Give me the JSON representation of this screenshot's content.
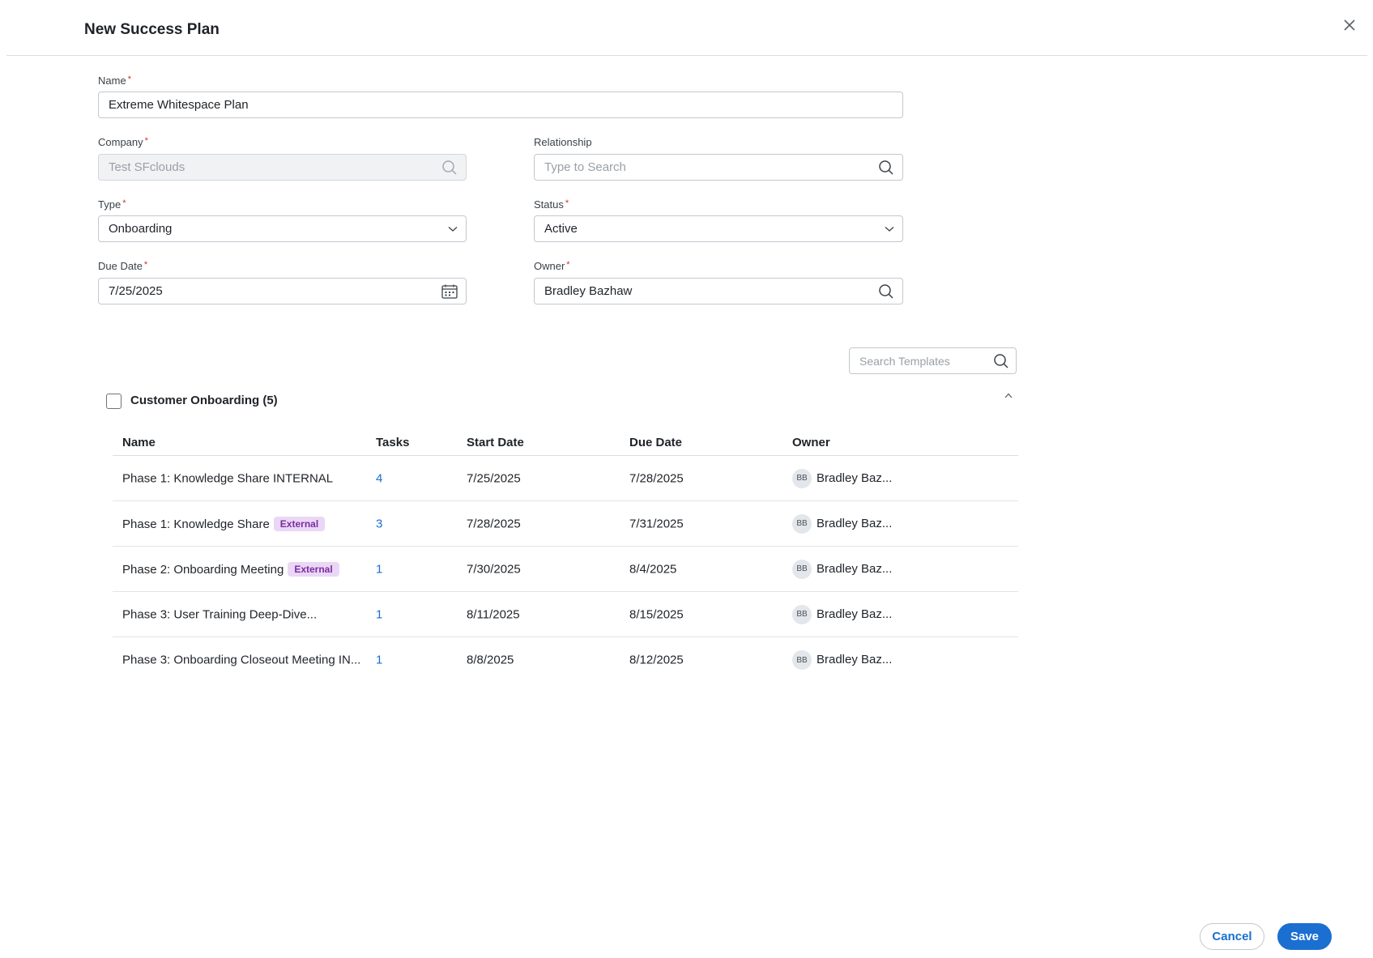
{
  "modal": {
    "title": "New Success Plan"
  },
  "form": {
    "name": {
      "label": "Name",
      "required_mark": "*",
      "value": "Extreme Whitespace Plan"
    },
    "company": {
      "label": "Company",
      "required_mark": "*",
      "value": "Test SFclouds"
    },
    "relationship": {
      "label": "Relationship",
      "placeholder": "Type to Search"
    },
    "type": {
      "label": "Type",
      "required_mark": "*",
      "value": "Onboarding"
    },
    "status": {
      "label": "Status",
      "required_mark": "*",
      "value": "Active"
    },
    "due_date": {
      "label": "Due Date",
      "required_mark": "*",
      "value": "7/25/2025"
    },
    "owner": {
      "label": "Owner",
      "required_mark": "*",
      "value": "Bradley Bazhaw"
    }
  },
  "templates": {
    "search_placeholder": "Search Templates",
    "group_title": "Customer Onboarding (5)",
    "columns": {
      "name": "Name",
      "tasks": "Tasks",
      "start": "Start Date",
      "due": "Due Date",
      "owner": "Owner"
    },
    "rows": [
      {
        "name": "Phase 1: Knowledge Share INTERNAL",
        "badge": "",
        "tasks": "4",
        "start": "7/25/2025",
        "due": "7/28/2025",
        "initials": "BB",
        "owner": "Bradley Baz..."
      },
      {
        "name": "Phase 1: Knowledge Share",
        "badge": "External",
        "tasks": "3",
        "start": "7/28/2025",
        "due": "7/31/2025",
        "initials": "BB",
        "owner": "Bradley Baz..."
      },
      {
        "name": "Phase 2: Onboarding Meeting",
        "badge": "External",
        "tasks": "1",
        "start": "7/30/2025",
        "due": "8/4/2025",
        "initials": "BB",
        "owner": "Bradley Baz..."
      },
      {
        "name": "Phase 3: User Training Deep-Dive...",
        "badge": "",
        "tasks": "1",
        "start": "8/11/2025",
        "due": "8/15/2025",
        "initials": "BB",
        "owner": "Bradley Baz..."
      },
      {
        "name": "Phase 3: Onboarding Closeout Meeting IN...",
        "badge": "",
        "tasks": "1",
        "start": "8/8/2025",
        "due": "8/12/2025",
        "initials": "BB",
        "owner": "Bradley Baz..."
      }
    ]
  },
  "footer": {
    "cancel_label": "Cancel",
    "save_label": "Save"
  },
  "icons": {
    "close": "close-icon",
    "search": "search-icon",
    "chevron": "chevron-down-icon",
    "calendar": "calendar-icon",
    "collapse": "chevron-up-icon"
  },
  "colors": {
    "primary": "#1a6fd1",
    "badge_bg": "#ead7f6",
    "badge_text": "#7b2c9e",
    "required": "#d0312d"
  }
}
